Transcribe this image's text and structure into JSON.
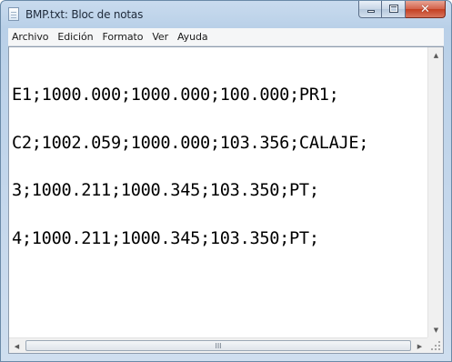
{
  "window": {
    "title": "BMP.txt: Bloc de notas",
    "app_icon": "notepad-icon",
    "buttons": {
      "minimize": "minimize-icon",
      "maximize": "maximize-icon",
      "close": "close-icon",
      "close_glyph": "✕"
    }
  },
  "menu": {
    "items": [
      "Archivo",
      "Edición",
      "Formato",
      "Ver",
      "Ayuda"
    ]
  },
  "editor": {
    "lines": [
      "E1;1000.000;1000.000;100.000;PR1;",
      "C2;1002.059;1000.000;103.356;CALAJE;",
      "3;1000.211;1000.345;103.350;PT;",
      "4;1000.211;1000.345;103.350;PT;"
    ]
  },
  "scrollbars": {
    "up": "▲",
    "down": "▼",
    "left": "◀",
    "right": "▶",
    "grip": "III"
  },
  "colors": {
    "titlebar": "#c9dbee",
    "close_button": "#c43f22",
    "menubar": "#f5f6f7"
  }
}
